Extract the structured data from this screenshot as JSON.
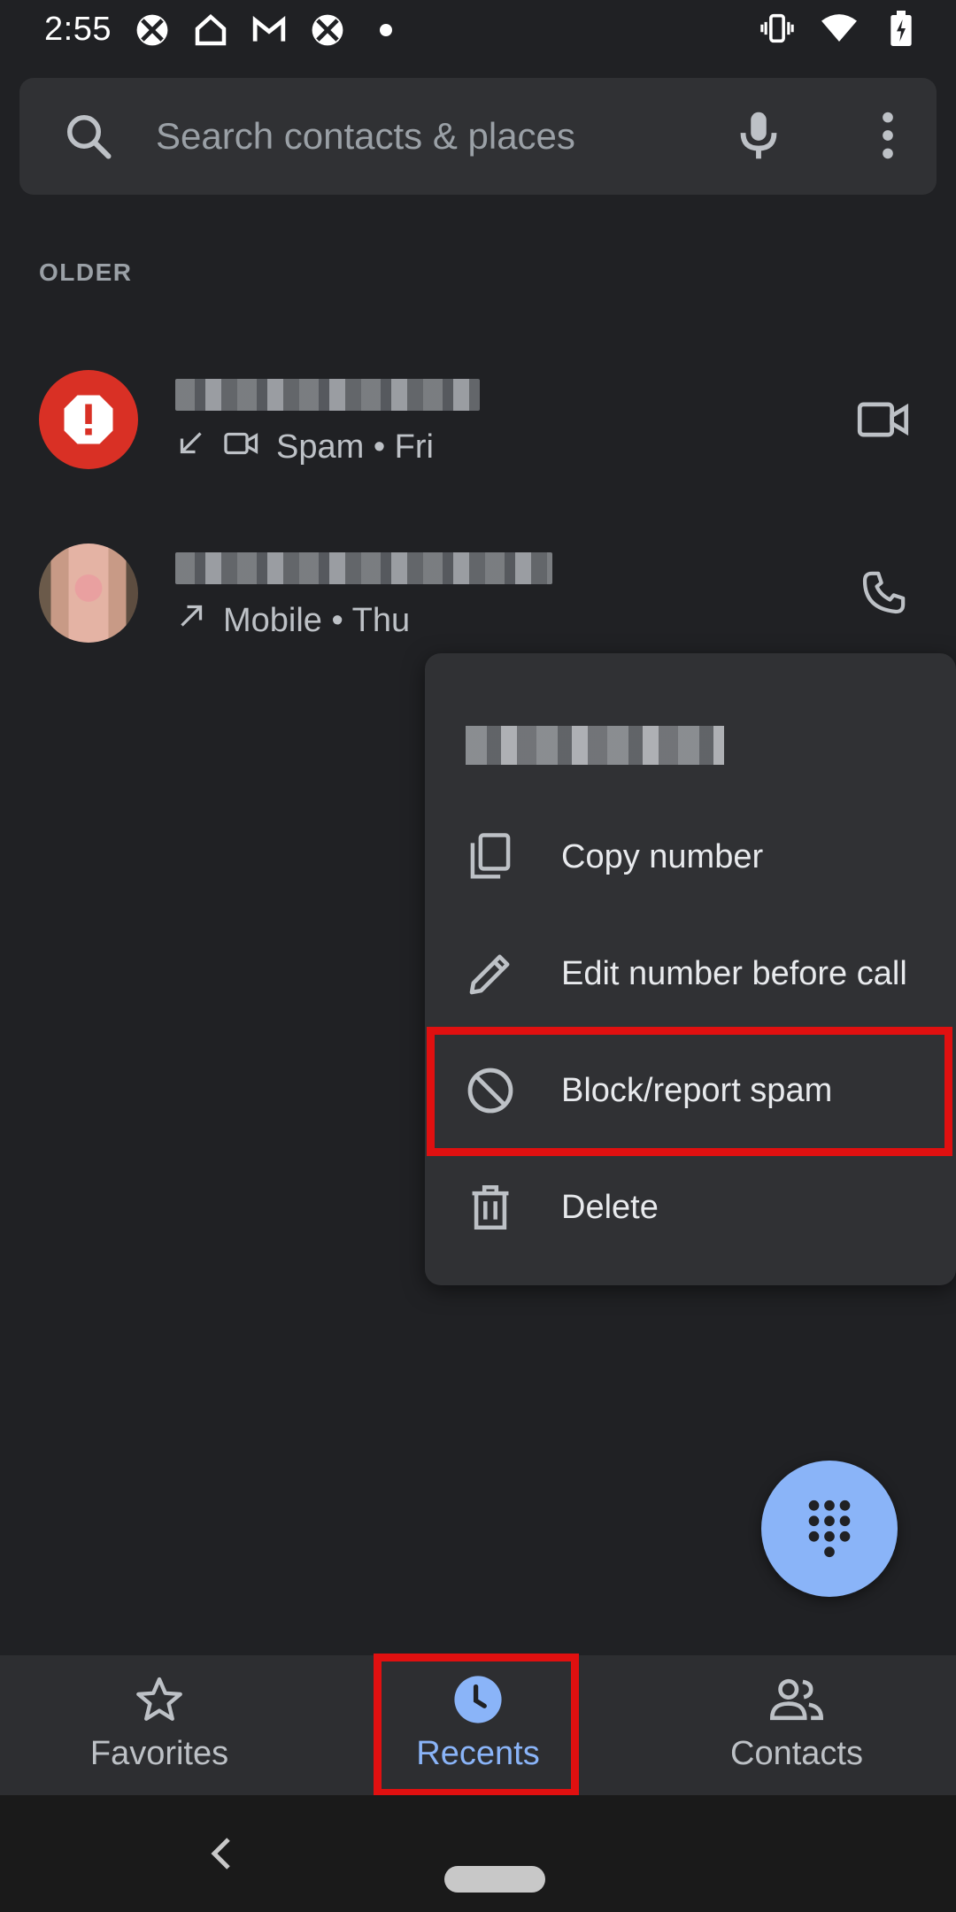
{
  "status_bar": {
    "time": "2:55",
    "left_icons": [
      "xbox-icon",
      "home-icon",
      "gmail-icon",
      "xbox-icon",
      "dot-icon"
    ],
    "right_icons": [
      "vibrate-icon",
      "wifi-icon",
      "battery-charging-icon"
    ]
  },
  "search": {
    "placeholder": "Search contacts & places"
  },
  "section": {
    "header": "OLDER"
  },
  "calls": [
    {
      "type_icon": "incoming-missed-arrow-icon",
      "media_icon": "video-icon",
      "subtitle": "Spam • Fri",
      "action_icon": "video-call-icon"
    },
    {
      "type_icon": "outgoing-arrow-icon",
      "subtitle": "Mobile • Thu",
      "action_icon": "phone-icon"
    }
  ],
  "context_menu": {
    "items": [
      {
        "label": "Copy number",
        "icon": "copy-icon"
      },
      {
        "label": "Edit number before call",
        "icon": "pencil-icon"
      },
      {
        "label": "Block/report spam",
        "icon": "block-icon"
      },
      {
        "label": "Delete",
        "icon": "trash-icon"
      }
    ]
  },
  "bottom_nav": {
    "tabs": [
      {
        "label": "Favorites",
        "icon": "star-icon"
      },
      {
        "label": "Recents",
        "icon": "clock-icon"
      },
      {
        "label": "Contacts",
        "icon": "people-icon"
      }
    ],
    "active": "Recents"
  },
  "colors": {
    "background": "#202124",
    "surface": "#303134",
    "accent": "#8ab4f8",
    "spam_red": "#d93025",
    "highlight": "#e01010"
  }
}
